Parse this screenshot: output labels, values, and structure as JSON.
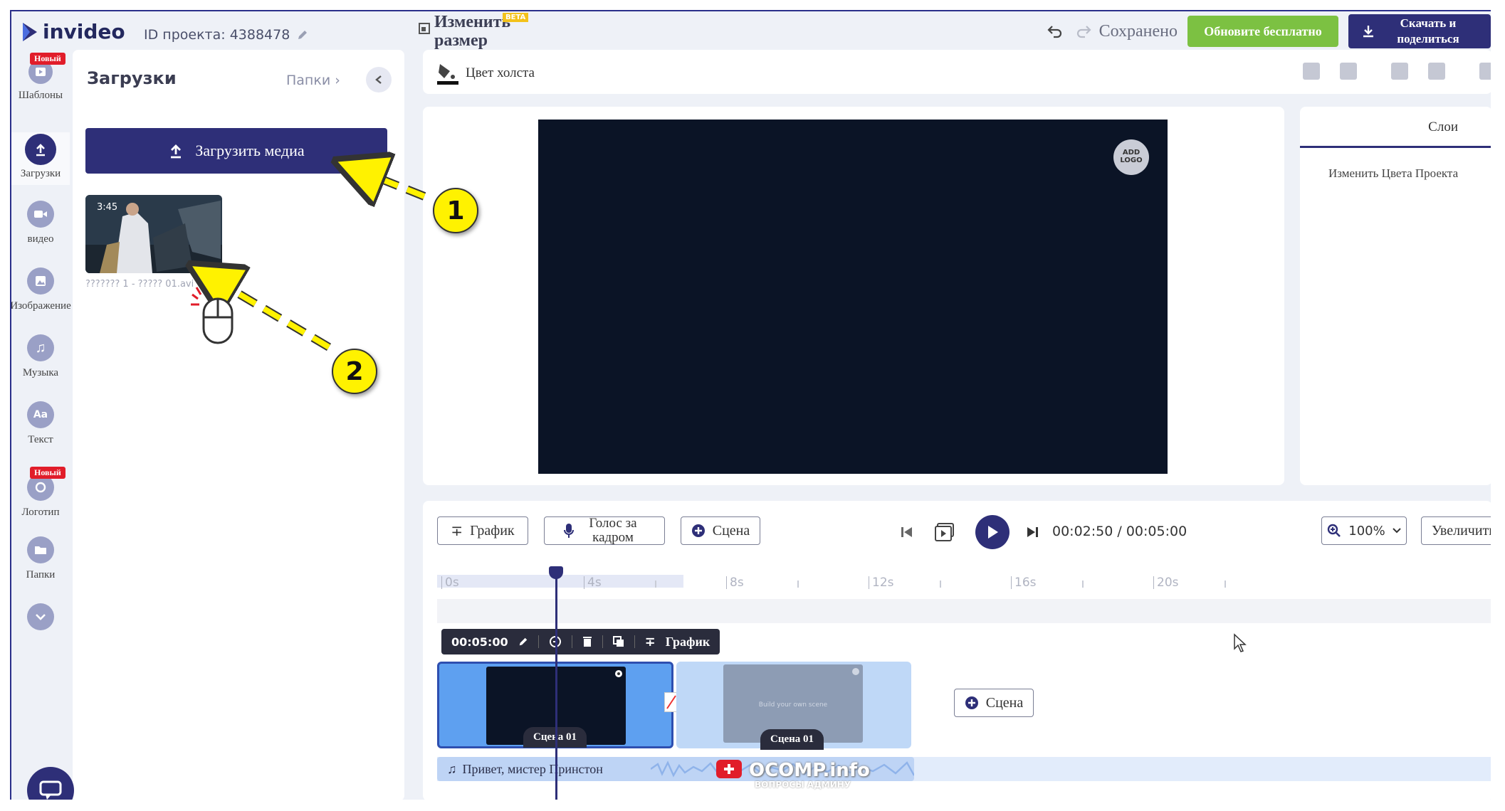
{
  "header": {
    "logo_text": "invideo",
    "project_id": "ID проекта: 4388478",
    "resize_label": "Изменить размер",
    "beta_badge": "BETA",
    "saved_label": "Сохранено",
    "upgrade_button": "Обновите бесплатно",
    "download_button": "Скачать и поделиться"
  },
  "sidebar": {
    "items": [
      {
        "label": "Шаблоны",
        "icon": "templates-icon",
        "badge": "Новый"
      },
      {
        "label": "Загрузки",
        "icon": "upload-icon"
      },
      {
        "label": "видео",
        "icon": "video-icon"
      },
      {
        "label": "Изображение",
        "icon": "image-icon"
      },
      {
        "label": "Музыка",
        "icon": "music-icon"
      },
      {
        "label": "Текст",
        "icon": "text-icon",
        "glyph": "Aa"
      },
      {
        "label": "Логотип",
        "icon": "logo-icon",
        "badge": "Новый"
      },
      {
        "label": "Папки",
        "icon": "folder-icon"
      }
    ]
  },
  "panel": {
    "title": "Загрузки",
    "folders_link": "Папки",
    "upload_button": "Загрузить медиа",
    "media": [
      {
        "duration": "3:45",
        "filename": "??????? 1 - ????? 01.avi"
      }
    ]
  },
  "canvas_toolbar": {
    "canvas_color_label": "Цвет холста"
  },
  "preview": {
    "add_logo_line1": "ADD",
    "add_logo_line2": "LOGO"
  },
  "layers": {
    "tab_label": "Слои",
    "change_colors": "Изменить Цвета Проекта"
  },
  "timeline": {
    "graph_button": "График",
    "voiceover_button": "Голос за кадром",
    "scene_button": "Сцена",
    "current_time": "00:02:50",
    "total_time": "00:05:00",
    "zoom_value": "100%",
    "zoom_in_button": "Увеличить",
    "ruler_ticks": [
      "0s",
      "4s",
      "8s",
      "12s",
      "16s",
      "20s"
    ],
    "scene_toolbar": {
      "duration": "00:05:00",
      "graph_label": "График"
    },
    "clips": [
      {
        "label": "Сцена 01"
      },
      {
        "label": "Сцена 01",
        "placeholder": "Build your own scene"
      }
    ],
    "add_scene_button": "Сцена",
    "audio_track": "Привет, мистер Принстон"
  },
  "annotations": {
    "callout_1": "1",
    "callout_2": "2",
    "watermark": "OCOMP.info",
    "watermark_sub": "ВОПРОСЫ АДМИНУ"
  },
  "colors": {
    "brand_dark": "#2e2f78",
    "upgrade_green": "#7cc142",
    "new_badge": "#e11d2a",
    "callout_yellow": "#fff200"
  }
}
